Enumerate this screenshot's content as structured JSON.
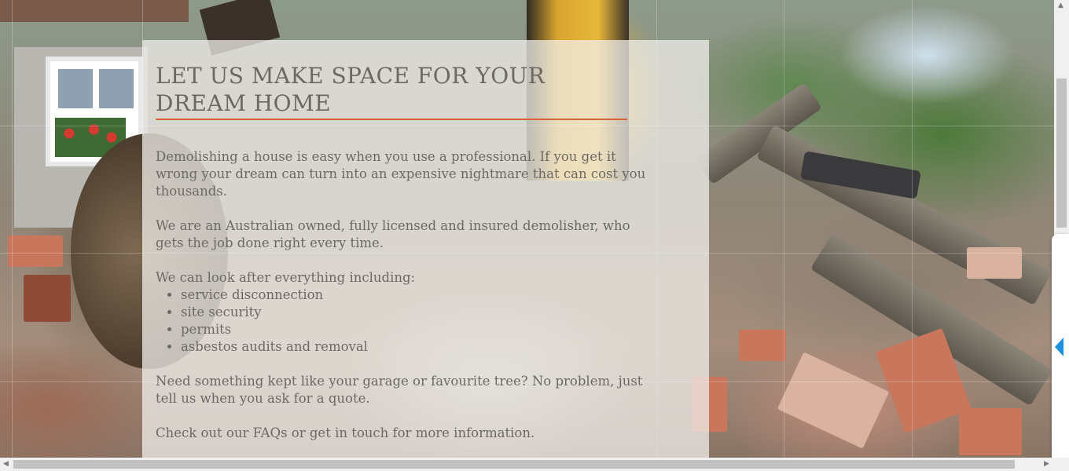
{
  "hero": {
    "title_line1": "LET US MAKE SPACE FOR YOUR",
    "title_line2": "DREAM HOME",
    "accent_color": "#d8623a",
    "paragraphs": {
      "p1": "Demolishing a house is easy when you use a professional. If you get it wrong your dream can turn into an expensive nightmare that can cost you thousands.",
      "p2": "We are an Australian owned, fully licensed and insured demolisher, who gets the job done right every time.",
      "p3": "We can look after everything including:",
      "p4": "Need something kept like your garage or favourite tree? No problem, just tell us when you ask for a quote.",
      "p5": "Check out our FAQs or get in touch for more information."
    },
    "services": [
      "service disconnection",
      "site security",
      "permits",
      "asbestos audits and removal"
    ]
  },
  "scrollbars": {
    "up_arrow": "▲",
    "down_arrow": "▼",
    "left_arrow": "◀",
    "right_arrow": "▶"
  },
  "side_tab": {
    "icon": "chevron-left-icon",
    "color": "#1e90e0"
  }
}
